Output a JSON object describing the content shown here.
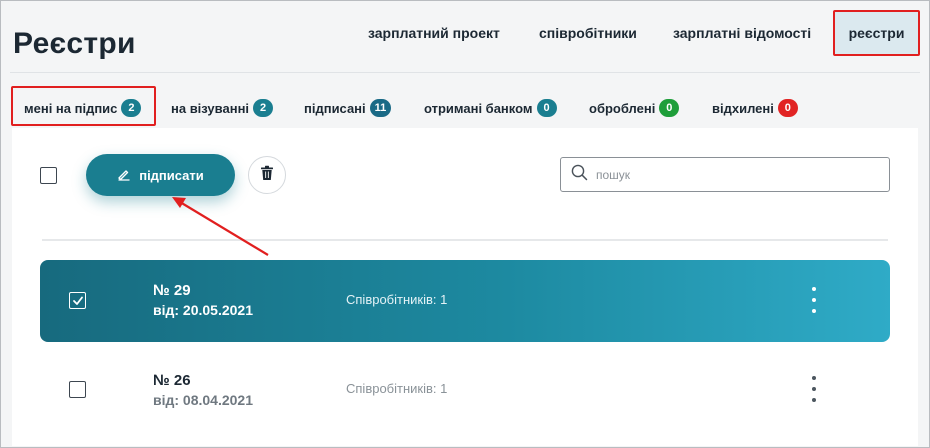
{
  "header": {
    "title": "Реєстри",
    "nav": [
      {
        "label": "зарплатний проект"
      },
      {
        "label": "співробітники"
      },
      {
        "label": "зарплатні відомості"
      },
      {
        "label": "реєстри",
        "active": true
      }
    ]
  },
  "tabs": [
    {
      "label": "мені на підпис",
      "count": "2",
      "badge_color": "#1a7e90",
      "active": true
    },
    {
      "label": "на візуванні",
      "count": "2",
      "badge_color": "#1a7e90"
    },
    {
      "label": "підписані",
      "count": "11",
      "badge_color": "#1a6a86"
    },
    {
      "label": "отримані банком",
      "count": "0",
      "badge_color": "#1a7e90"
    },
    {
      "label": "оброблені",
      "count": "0",
      "badge_color": "#1e9e3a"
    },
    {
      "label": "відхилені",
      "count": "0",
      "badge_color": "#e12424"
    }
  ],
  "toolbar": {
    "sign_label": "підписати",
    "sign_icon": "pen-icon",
    "delete_icon": "trash-icon",
    "search_placeholder": "пошук",
    "search_icon": "search-icon"
  },
  "rows": [
    {
      "number": "№ 29",
      "date": "від: 20.05.2021",
      "employees": "Співробітників: 1",
      "selected": true
    },
    {
      "number": "№ 26",
      "date": "від: 08.04.2021",
      "employees": "Співробітників: 1",
      "selected": false
    }
  ],
  "colors": {
    "accent": "#1a7e90",
    "annotation": "#e11f1f"
  }
}
